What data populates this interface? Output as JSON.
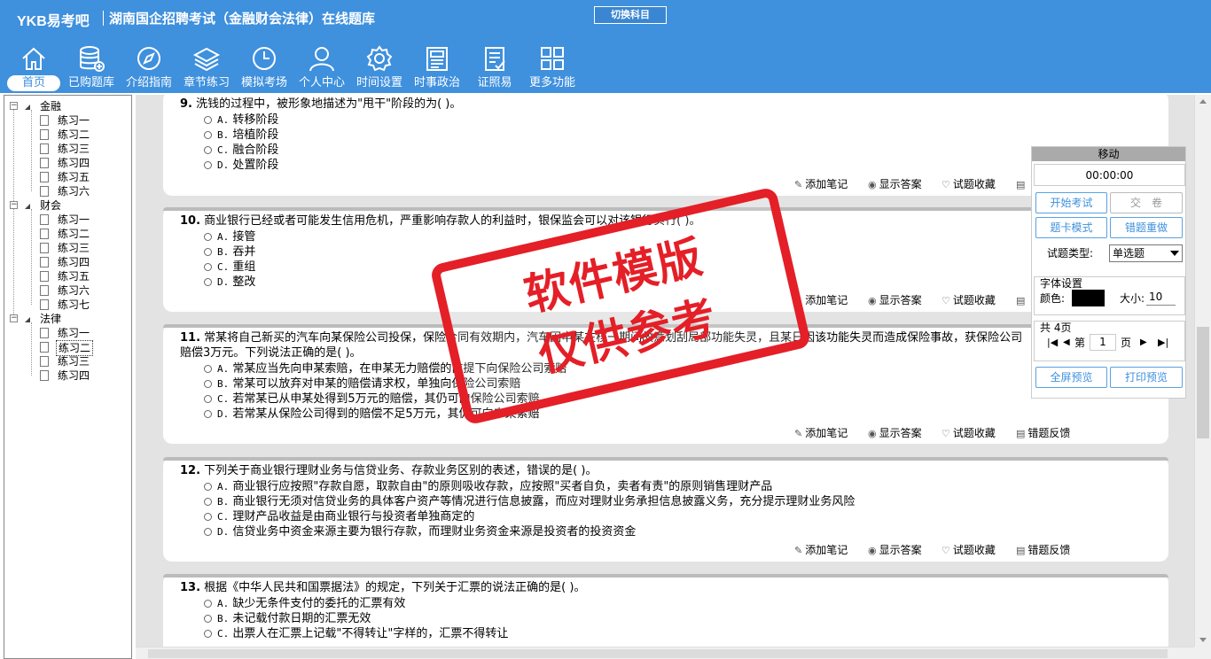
{
  "header": {
    "logo": "YKB易考吧",
    "title": "湖南国企招聘考试（金融财会法律）在线题库",
    "switch_label": "切换科目"
  },
  "nav": [
    {
      "label": "首页",
      "icon": "home-icon"
    },
    {
      "label": "已购题库",
      "icon": "database-icon"
    },
    {
      "label": "介绍指南",
      "icon": "compass-icon"
    },
    {
      "label": "章节练习",
      "icon": "layers-icon"
    },
    {
      "label": "模拟考场",
      "icon": "clock-icon"
    },
    {
      "label": "个人中心",
      "icon": "user-icon"
    },
    {
      "label": "时间设置",
      "icon": "gear-icon"
    },
    {
      "label": "时事政治",
      "icon": "newspaper-icon"
    },
    {
      "label": "证照易",
      "icon": "checklist-icon"
    },
    {
      "label": "更多功能",
      "icon": "grid-icon"
    }
  ],
  "tree": {
    "groups": [
      {
        "label": "金融",
        "items": [
          "练习一",
          "练习二",
          "练习三",
          "练习四",
          "练习五",
          "练习六"
        ]
      },
      {
        "label": "财会",
        "items": [
          "练习一",
          "练习二",
          "练习三",
          "练习四",
          "练习五",
          "练习六",
          "练习七"
        ]
      },
      {
        "label": "法律",
        "items": [
          "练习一",
          "练习二",
          "练习三",
          "练习四"
        ]
      }
    ],
    "selected": "法律/练习二"
  },
  "actions": {
    "note": "添加笔记",
    "answer": "显示答案",
    "favorite": "试题收藏",
    "report": "错题反馈"
  },
  "questions": [
    {
      "num": "9.",
      "stem": "洗钱的过程中，被形象地描述为\"甩干\"阶段的为(  )。",
      "options": [
        {
          "letter": "A.",
          "text": "转移阶段"
        },
        {
          "letter": "B.",
          "text": "培植阶段"
        },
        {
          "letter": "C.",
          "text": "融合阶段"
        },
        {
          "letter": "D.",
          "text": "处置阶段"
        }
      ]
    },
    {
      "num": "10.",
      "stem": "商业银行已经或者可能发生信用危机，严重影响存款人的利益时，银保监会可以对该银行实行(  )。",
      "options": [
        {
          "letter": "A.",
          "text": "接管"
        },
        {
          "letter": "B.",
          "text": "吞并"
        },
        {
          "letter": "C.",
          "text": "重组"
        },
        {
          "letter": "D.",
          "text": "整改"
        }
      ]
    },
    {
      "num": "11.",
      "stem": "常某将自己新买的汽车向某保险公司投保，保险合同有效期内，汽车因申某在核一期间故意划刮局部功能失灵，且某日因该功能失灵而造成保险事故，获保险公司赔偿3万元。下列说法正确的是(  )。",
      "options": [
        {
          "letter": "A.",
          "text": "常某应当先向申某索赔，在申某无力赔偿的前提下向保险公司索赔"
        },
        {
          "letter": "B.",
          "text": "常某可以放弃对申某的赔偿请求权，单独向保险公司索赔"
        },
        {
          "letter": "C.",
          "text": "若常某已从申某处得到5万元的赔偿，其仍可向保险公司索赔"
        },
        {
          "letter": "D.",
          "text": "若常某从保险公司得到的赔偿不足5万元，其仍可向申某索赔"
        }
      ]
    },
    {
      "num": "12.",
      "stem": "下列关于商业银行理财业务与信贷业务、存款业务区别的表述，错误的是(  )。",
      "options": [
        {
          "letter": "A.",
          "text": "商业银行应按照\"存款自愿，取款自由\"的原则吸收存款，应按照\"买者自负，卖者有责\"的原则销售理财产品"
        },
        {
          "letter": "B.",
          "text": "商业银行无须对信贷业务的具体客户资产等情况进行信息披露，而应对理财业务承担信息披露义务，充分提示理财业务风险"
        },
        {
          "letter": "C.",
          "text": "理财产品收益是由商业银行与投资者单独商定的"
        },
        {
          "letter": "D.",
          "text": "信贷业务中资金来源主要为银行存款，而理财业务资金来源是投资者的投资资金"
        }
      ]
    },
    {
      "num": "13.",
      "stem": "根据《中华人民共和国票据法》的规定，下列关于汇票的说法正确的是(  )。",
      "options": [
        {
          "letter": "A.",
          "text": "缺少无条件支付的委托的汇票有效"
        },
        {
          "letter": "B.",
          "text": "未记载付款日期的汇票无效"
        },
        {
          "letter": "C.",
          "text": "出票人在汇票上记载\"不得转让\"字样的，汇票不得转让"
        }
      ]
    }
  ],
  "panel": {
    "head": "移动",
    "timer": "00:00:00",
    "start": "开始考试",
    "submit": "交　卷",
    "card_mode": "题卡模式",
    "redo_wrong": "错题重做",
    "type_label": "试题类型:",
    "type_value": "单选题",
    "font_title": "字体设置",
    "color_label": "颜色:",
    "size_label": "大小:",
    "size_value": "10",
    "color_value": "#000000",
    "pages_label": "共 4页",
    "page_prefix": "第",
    "page_value": "1",
    "page_suffix": "页",
    "fullscreen": "全屏预览",
    "print": "打印预览"
  },
  "watermark": {
    "line1": "软件模版",
    "line2": "仅供参考"
  }
}
